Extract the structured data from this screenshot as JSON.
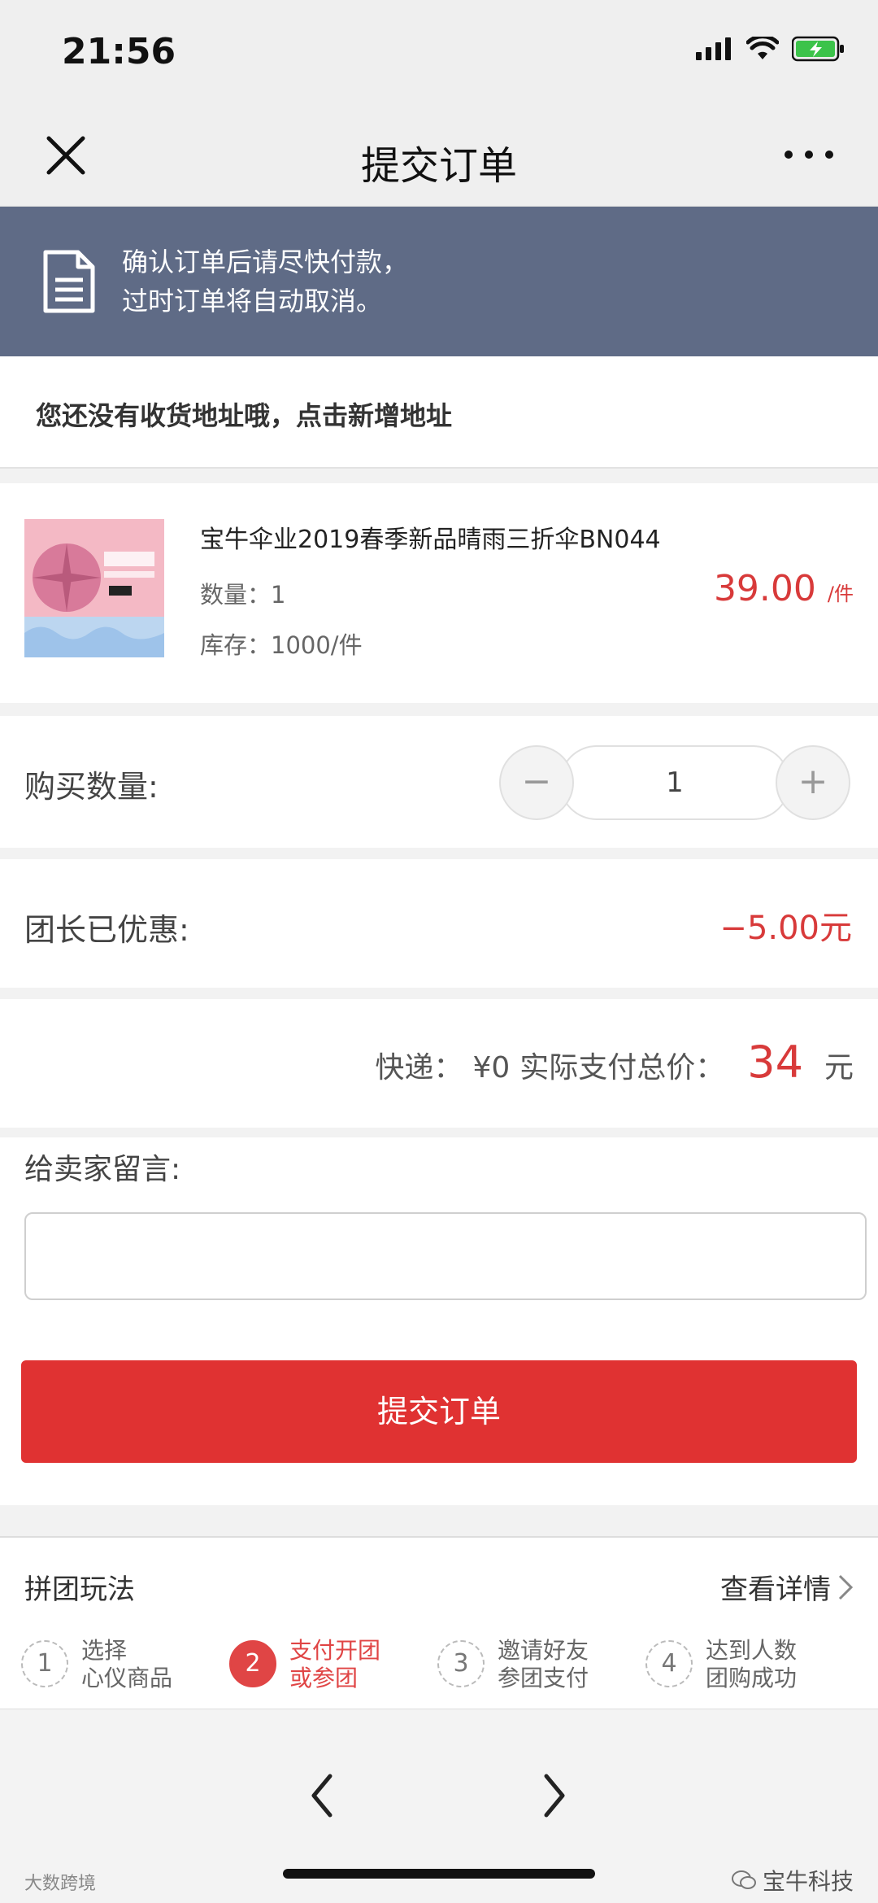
{
  "status_bar": {
    "time": "21:56"
  },
  "nav": {
    "title": "提交订单"
  },
  "notice": {
    "line1": "确认订单后请尽快付款，",
    "line2": "过时订单将自动取消。"
  },
  "address": {
    "prompt": "您还没有收货地址哦，点击新增地址"
  },
  "product": {
    "name": "宝牛伞业2019春季新品晴雨三折伞BN044",
    "quantity_text": "数量：1",
    "stock_text": "库存：1000/件",
    "price": "39.00",
    "price_unit": "/件"
  },
  "purchase_qty": {
    "label": "购买数量:",
    "minus": "−",
    "value": "1",
    "plus": "+"
  },
  "discount": {
    "label": "团长已优惠:",
    "value": "−5.00元"
  },
  "total": {
    "shipping_label": "快递：",
    "shipping_value": "¥0",
    "total_label": "实际支付总价：",
    "amount": "34",
    "currency": "元"
  },
  "message": {
    "label": "给卖家留言:",
    "value": ""
  },
  "submit": {
    "label": "提交订单"
  },
  "group_buy": {
    "title": "拼团玩法",
    "detail_link": "查看详情",
    "steps": [
      {
        "num": "1",
        "line1": "选择",
        "line2": "心仪商品",
        "active": false
      },
      {
        "num": "2",
        "line1": "支付开团",
        "line2": "或参团",
        "active": true
      },
      {
        "num": "3",
        "line1": "邀请好友",
        "line2": "参团支付",
        "active": false
      },
      {
        "num": "4",
        "line1": "达到人数",
        "line2": "团购成功",
        "active": false
      }
    ]
  },
  "watermarks": {
    "left": "大数跨境",
    "right": "宝牛科技"
  },
  "colors": {
    "accent_red": "#e03232",
    "notice_bg": "#5f6b86",
    "price_red": "#d83a3a"
  }
}
